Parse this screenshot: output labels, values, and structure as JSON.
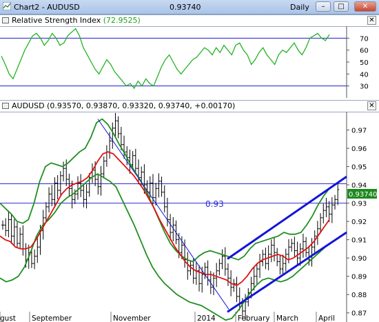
{
  "window": {
    "title": "Chart2 - AUDUSD",
    "price": "0.93740",
    "period": "Daily",
    "icon": "chart-icon",
    "buttons": {
      "minimize": "–",
      "maximize": "□",
      "close": "✕"
    }
  },
  "rsi_panel": {
    "title": "Relative Strength Index",
    "value": "(72.9525)",
    "close_glyph": "✕",
    "y_ticks": [
      "70",
      "60",
      "50",
      "40",
      "30"
    ],
    "y_tick_values": [
      70,
      60,
      50,
      40,
      30
    ],
    "levels": [
      70,
      30
    ],
    "colors": {
      "line": "#22b322",
      "level": "#1c1cd4"
    }
  },
  "price_panel": {
    "title": "AUDUSD (0.93570, 0.93870, 0.93320, 0.93740, +0.00170)",
    "close_glyph": "✕",
    "annotation": "0.93",
    "last_price_label": "0.93740",
    "y_ticks": [
      "0.97",
      "0.96",
      "0.95",
      "0.94",
      "0.93",
      "0.92",
      "0.91",
      "0.90",
      "0.89",
      "0.88",
      "0.87"
    ],
    "y_tick_values": [
      0.97,
      0.96,
      0.95,
      0.94,
      0.93,
      0.92,
      0.91,
      0.9,
      0.89,
      0.88,
      0.87
    ],
    "x_labels": [
      "gust",
      "September",
      "November",
      "2014",
      "February",
      "March",
      "April"
    ],
    "horizontal_levels": [
      0.9406,
      0.93
    ],
    "colors": {
      "bars": "#000000",
      "moving_average": "#e01010",
      "bands": "#1f8f1f",
      "channel": "#1414d8",
      "level": "#2b2bd0",
      "price_label_bg": "#1e8a1e",
      "price_label_fg": "#ffffff"
    }
  },
  "chart_data": {
    "type": "line",
    "title": "AUDUSD",
    "series": [
      {
        "name": "AUDUSD",
        "values": [
          0.918,
          0.915,
          0.921,
          0.912,
          0.917,
          0.908,
          0.913,
          0.905,
          0.899,
          0.903,
          0.897,
          0.901,
          0.906,
          0.915,
          0.922,
          0.928,
          0.935,
          0.932,
          0.941,
          0.937,
          0.945,
          0.949,
          0.943,
          0.938,
          0.932,
          0.935,
          0.941,
          0.937,
          0.932,
          0.936,
          0.944,
          0.948,
          0.943,
          0.939,
          0.946,
          0.953,
          0.958,
          0.964,
          0.971,
          0.975,
          0.968,
          0.962,
          0.958,
          0.955,
          0.951,
          0.956,
          0.949,
          0.944,
          0.947,
          0.94,
          0.936,
          0.941,
          0.933,
          0.938,
          0.942,
          0.936,
          0.928,
          0.921,
          0.914,
          0.918,
          0.91,
          0.903,
          0.907,
          0.899,
          0.893,
          0.896,
          0.889,
          0.893,
          0.886,
          0.891,
          0.895,
          0.888,
          0.884,
          0.889,
          0.893,
          0.897,
          0.901,
          0.894,
          0.889,
          0.884,
          0.886,
          0.879,
          0.875,
          0.871,
          0.876,
          0.881,
          0.886,
          0.89,
          0.894,
          0.898,
          0.902,
          0.897,
          0.902,
          0.907,
          0.903,
          0.898,
          0.894,
          0.897,
          0.902,
          0.906,
          0.908,
          0.904,
          0.9,
          0.905,
          0.909,
          0.903,
          0.899,
          0.906,
          0.912,
          0.916,
          0.922,
          0.926,
          0.928,
          0.924,
          0.929,
          0.932,
          0.9374
        ]
      },
      {
        "name": "Moving Average",
        "values": [
          0.912,
          0.91,
          0.909,
          0.906,
          0.905,
          0.905,
          0.906,
          0.91,
          0.915,
          0.92,
          0.925,
          0.93,
          0.935,
          0.938,
          0.94,
          0.941,
          0.942,
          0.944,
          0.948,
          0.953,
          0.957,
          0.958,
          0.957,
          0.954,
          0.951,
          0.948,
          0.945,
          0.941,
          0.937,
          0.932,
          0.927,
          0.921,
          0.916,
          0.911,
          0.906,
          0.902,
          0.898,
          0.895,
          0.893,
          0.892,
          0.891,
          0.891,
          0.89,
          0.889,
          0.888,
          0.886,
          0.885,
          0.887,
          0.89,
          0.894,
          0.897,
          0.899,
          0.9,
          0.901,
          0.902,
          0.901,
          0.899,
          0.9,
          0.902,
          0.904,
          0.906,
          0.909,
          0.913,
          0.917,
          0.921
        ]
      },
      {
        "name": "Upper Band",
        "values": [
          0.93,
          0.927,
          0.924,
          0.92,
          0.919,
          0.921,
          0.93,
          0.942,
          0.95,
          0.952,
          0.951,
          0.95,
          0.952,
          0.955,
          0.958,
          0.96,
          0.966,
          0.974,
          0.976,
          0.973,
          0.968,
          0.962,
          0.957,
          0.951,
          0.946,
          0.941,
          0.935,
          0.928,
          0.921,
          0.914,
          0.908,
          0.904,
          0.901,
          0.899,
          0.898,
          0.901,
          0.903,
          0.904,
          0.903,
          0.902,
          0.901,
          0.9,
          0.899,
          0.901,
          0.905,
          0.908,
          0.909,
          0.91,
          0.911,
          0.912,
          0.914,
          0.913,
          0.913,
          0.914,
          0.918,
          0.923,
          0.929,
          0.934,
          0.938
        ]
      },
      {
        "name": "Lower Band",
        "values": [
          0.889,
          0.887,
          0.888,
          0.89,
          0.895,
          0.903,
          0.912,
          0.918,
          0.921,
          0.925,
          0.93,
          0.933,
          0.935,
          0.938,
          0.941,
          0.944,
          0.946,
          0.944,
          0.942,
          0.939,
          0.932,
          0.925,
          0.918,
          0.91,
          0.902,
          0.895,
          0.89,
          0.886,
          0.883,
          0.88,
          0.878,
          0.876,
          0.875,
          0.874,
          0.872,
          0.87,
          0.868,
          0.866,
          0.867,
          0.871,
          0.876,
          0.881,
          0.885,
          0.888,
          0.889,
          0.888,
          0.887,
          0.888,
          0.89,
          0.893,
          0.896,
          0.899,
          0.902,
          0.905,
          0.908
        ]
      },
      {
        "name": "RSI",
        "values": [
          55,
          48,
          40,
          36,
          44,
          52,
          60,
          66,
          72,
          74,
          70,
          64,
          68,
          74,
          70,
          64,
          66,
          72,
          75,
          78,
          72,
          62,
          56,
          50,
          44,
          40,
          46,
          52,
          48,
          42,
          38,
          34,
          30,
          32,
          28,
          34,
          30,
          36,
          32,
          30,
          38,
          46,
          52,
          56,
          50,
          44,
          40,
          44,
          48,
          52,
          54,
          58,
          62,
          60,
          56,
          62,
          58,
          64,
          60,
          56,
          64,
          66,
          60,
          56,
          48,
          52,
          58,
          62,
          56,
          52,
          48,
          56,
          60,
          58,
          62,
          66,
          60,
          56,
          62,
          70,
          72,
          74,
          70,
          68,
          73
        ]
      }
    ],
    "ylim": [
      0.865,
      0.98
    ],
    "rsi_ylim": [
      20,
      80
    ],
    "channel": {
      "upper": [
        0.8995,
        0.9445
      ],
      "lower": [
        0.8705,
        0.914
      ]
    },
    "trendline": [
      0.976,
      0.872
    ]
  }
}
